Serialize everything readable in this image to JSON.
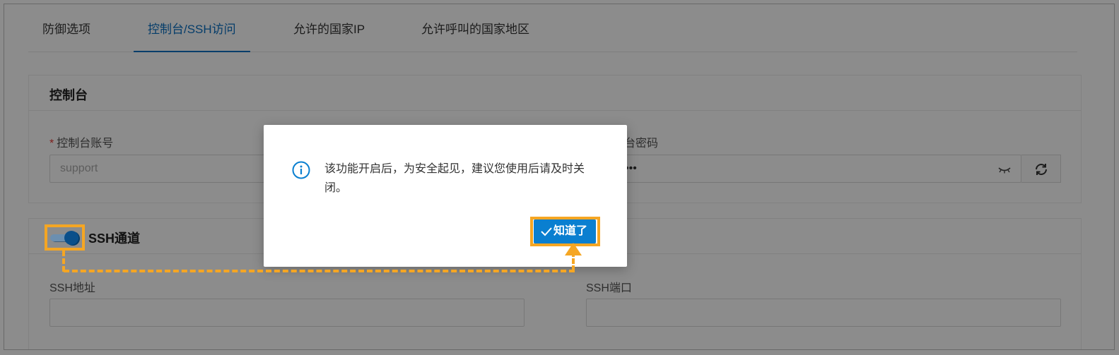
{
  "tabs": [
    {
      "label": "防御选项",
      "active": false
    },
    {
      "label": "控制台/SSH访问",
      "active": true
    },
    {
      "label": "允许的国家IP",
      "active": false
    },
    {
      "label": "允许呼叫的国家地区",
      "active": false
    }
  ],
  "console": {
    "title": "控制台",
    "account_label": "控制台账号",
    "account_required_mark": "*",
    "account_placeholder": "support",
    "password_label": "台密码",
    "password_value": "•••"
  },
  "ssh": {
    "title": "SSH通道",
    "enabled": true,
    "address_label": "SSH地址",
    "port_label": "SSH端口"
  },
  "modal": {
    "message": "该功能开启后，为安全起见，建议您使用后请及时关闭。",
    "ok_label": "知道了"
  },
  "colors": {
    "accent": "#0a6fc2",
    "highlight": "#f5a623"
  },
  "icons": {
    "info": "info-icon",
    "eye": "eye-closed-icon",
    "refresh": "refresh-icon",
    "check": "check-icon"
  }
}
